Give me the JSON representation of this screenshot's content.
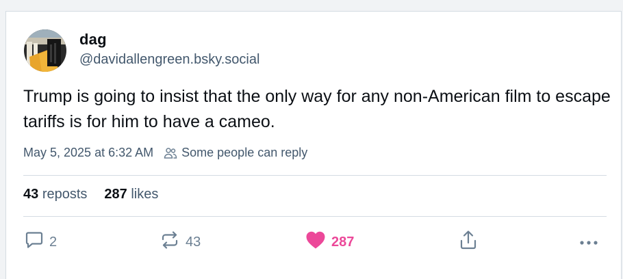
{
  "post": {
    "author": {
      "display_name": "dag",
      "handle": "@davidallengreen.bsky.social"
    },
    "text": "Trump is going to insist that the only way for any non-American film to escape tariffs is for him to have a cameo.",
    "timestamp": "May 5, 2025 at 6:32 AM",
    "reply_setting": "Some people can reply",
    "stats": {
      "reposts_count": "43",
      "reposts_label": "reposts",
      "likes_count": "287",
      "likes_label": "likes"
    },
    "actions": {
      "reply_count": "2",
      "repost_count": "43",
      "like_count": "287"
    }
  },
  "icons": {
    "reply": "reply-bubble-icon",
    "repost": "repost-icon",
    "like": "heart-icon",
    "share": "share-icon",
    "more": "more-icon",
    "people": "people-icon"
  },
  "colors": {
    "like_active": "#ec4899",
    "muted": "#42576c",
    "text": "#0b0f14"
  }
}
